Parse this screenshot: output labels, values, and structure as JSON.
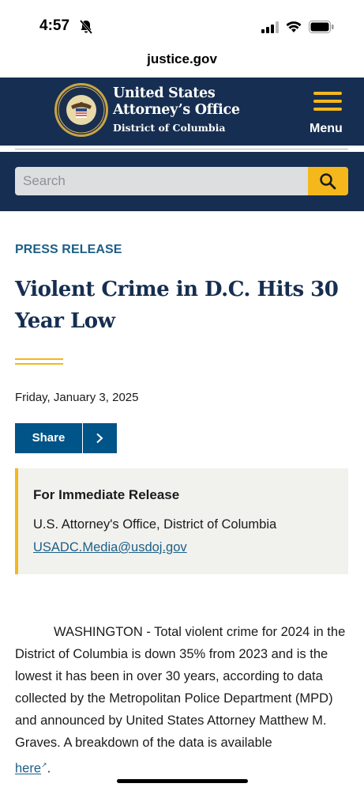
{
  "status_bar": {
    "time": "4:57"
  },
  "browser": {
    "url": "justice.gov"
  },
  "header": {
    "agency_line1": "United States",
    "agency_line2": "Attorney’s Office",
    "agency_sub": "District of Columbia",
    "menu_label": "Menu"
  },
  "search": {
    "placeholder": "Search"
  },
  "article": {
    "kicker": "PRESS RELEASE",
    "title": "Violent Crime in D.C. Hits 30 Year Low",
    "date": "Friday, January 3, 2025",
    "share_label": "Share"
  },
  "release_box": {
    "title": "For Immediate Release",
    "office": "U.S. Attorney's Office, District of Columbia",
    "email": "USADC.Media@usdoj.gov"
  },
  "body": {
    "paragraph": "WASHINGTON - Total violent crime for 2024 in the District of Columbia is down 35% from 2023 and is the lowest it has been in over 30 years, according to data collected by the Metropolitan Police Department (MPD) and announced by United States Attorney Matthew M. Graves. A breakdown of the data is available",
    "link_text": "here",
    "trailing": "."
  },
  "colors": {
    "navy": "#162e51",
    "gold": "#f4b81d",
    "link_blue": "#1d5f87",
    "share_blue": "#005487"
  }
}
